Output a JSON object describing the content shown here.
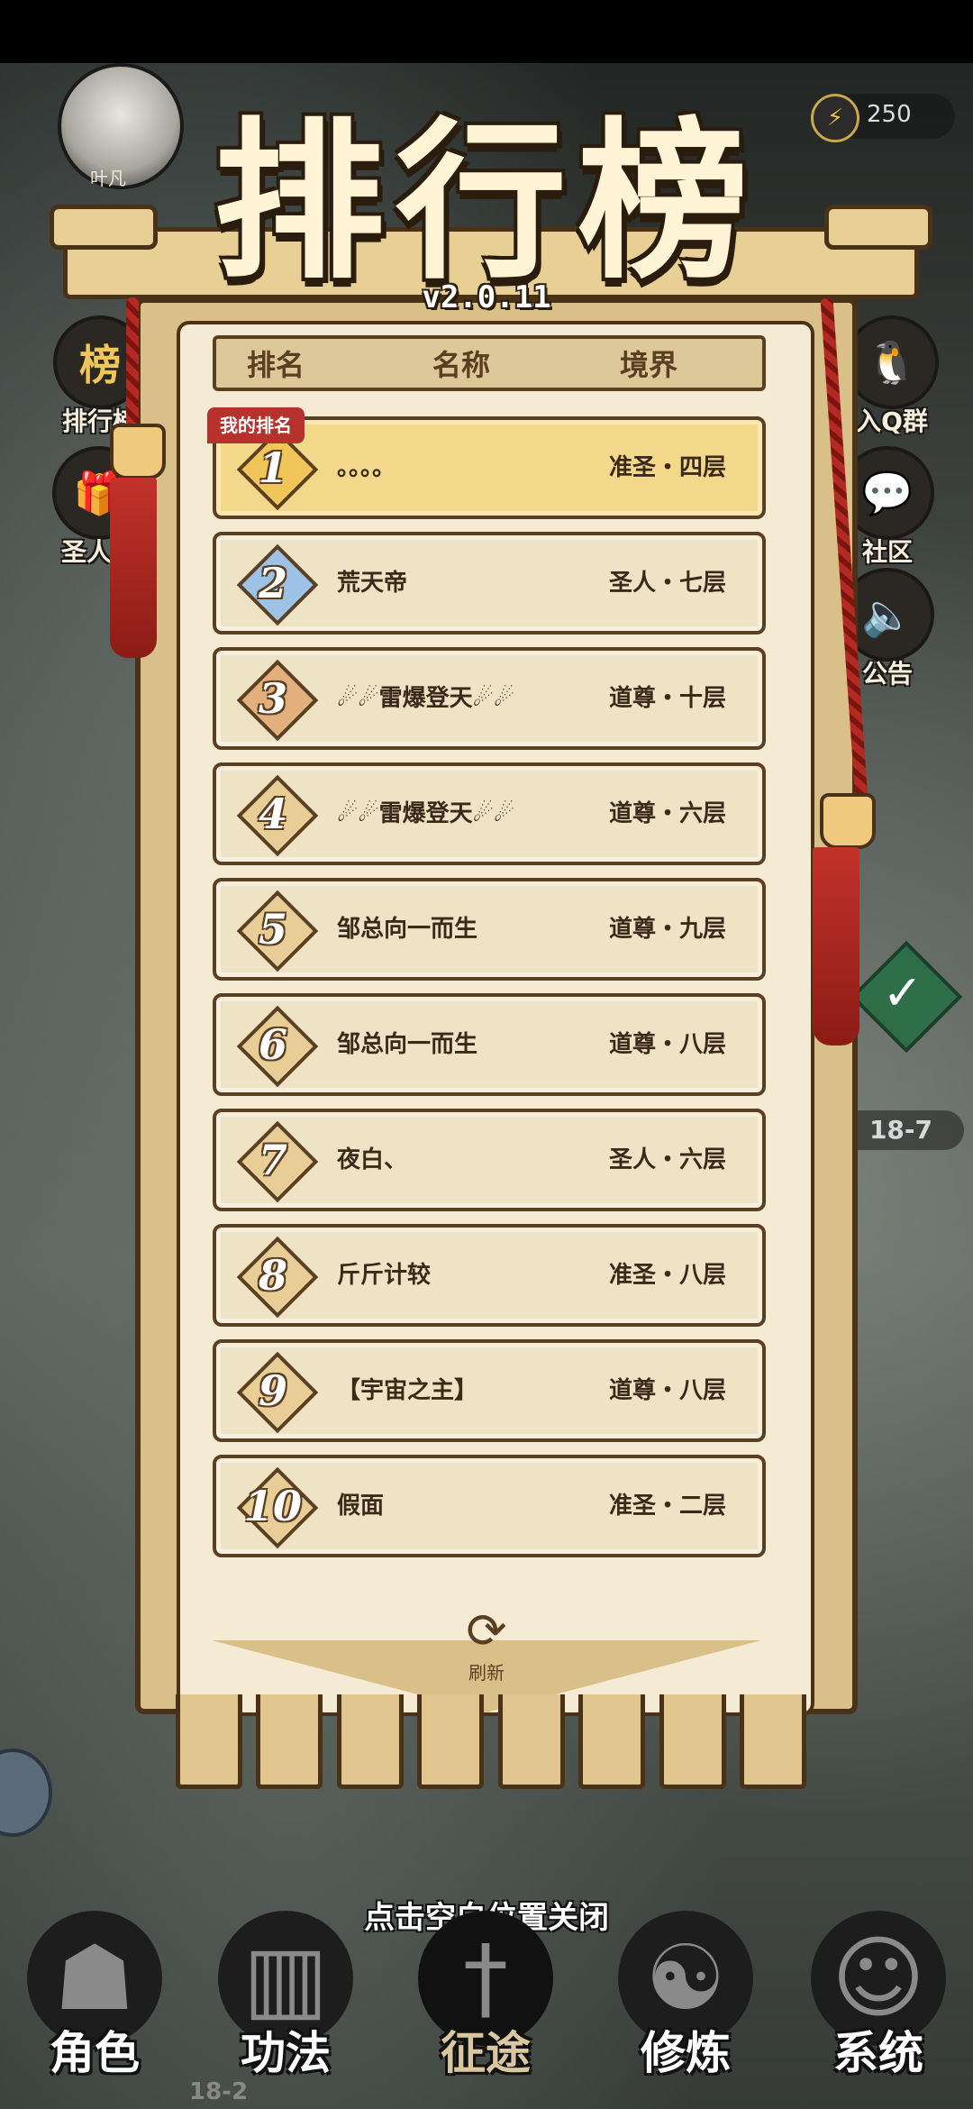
{
  "player": {
    "name": "叶凡"
  },
  "hud": {
    "energy": "250"
  },
  "title": "排行榜",
  "version": "v2.0.11",
  "columns": {
    "rank": "排名",
    "name": "名称",
    "realm": "境界"
  },
  "my_rank_tag": "我的排名",
  "rows": [
    {
      "rank": "1",
      "name": "。。。。",
      "realm": "准圣・四层"
    },
    {
      "rank": "2",
      "name": "荒天帝",
      "realm": "圣人・七层"
    },
    {
      "rank": "3",
      "name": "☄☄雷爆登天☄☄",
      "realm": "道尊・十层"
    },
    {
      "rank": "4",
      "name": "☄☄雷爆登天☄☄",
      "realm": "道尊・六层"
    },
    {
      "rank": "5",
      "name": "邹总向一而生",
      "realm": "道尊・九层"
    },
    {
      "rank": "6",
      "name": "邹总向一而生",
      "realm": "道尊・八层"
    },
    {
      "rank": "7",
      "name": "夜白、",
      "realm": "圣人・六层"
    },
    {
      "rank": "8",
      "name": "斤斤计较",
      "realm": "准圣・八层"
    },
    {
      "rank": "9",
      "name": "【宇宙之主】",
      "realm": "道尊・八层"
    },
    {
      "rank": "10",
      "name": "假面",
      "realm": "准圣・二层"
    }
  ],
  "refresh_label": "刷新",
  "side_left": {
    "leaderboard": "排行榜",
    "gift": "圣人礼"
  },
  "side_right": {
    "qq": "入Q群",
    "community": "社区",
    "notice": "公告"
  },
  "stage": {
    "current": "18-7",
    "bottom": "18-2"
  },
  "close_hint": "点击空白位置关闭",
  "nav": {
    "role": "角色",
    "skills": "功法",
    "journey": "征途",
    "cultivate": "修炼",
    "system": "系统"
  },
  "colors": {
    "accent": "#b8322d",
    "banner": "#d9c089",
    "row": "#efe3c6",
    "mine_row": "#f3d78a"
  }
}
